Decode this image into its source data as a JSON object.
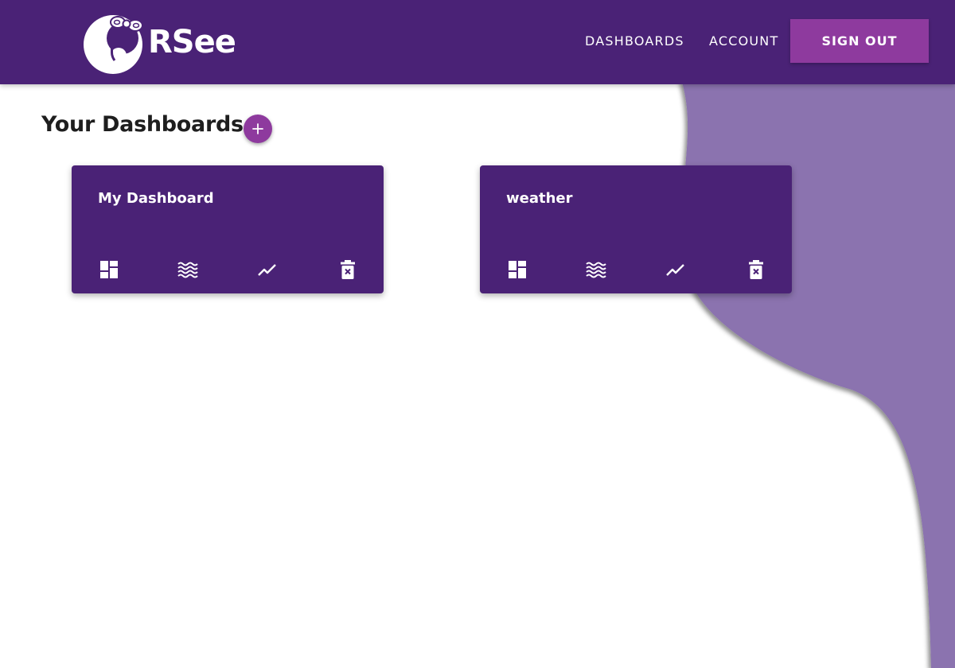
{
  "app": {
    "brand": "RSee",
    "brand_color": "#4a2276",
    "accent_color": "#8e3a9e",
    "wave_color": "#8b73af"
  },
  "header": {
    "nav": [
      {
        "label": "DASHBOARDS"
      },
      {
        "label": "ACCOUNT"
      }
    ],
    "signout_label": "SIGN OUT"
  },
  "main": {
    "title": "Your Dashboards",
    "add_icon": "plus-icon",
    "cards": [
      {
        "title": "My Dashboard",
        "actions": [
          "dashboard-icon",
          "waves-icon",
          "trending-icon",
          "delete-icon"
        ]
      },
      {
        "title": "weather",
        "actions": [
          "dashboard-icon",
          "waves-icon",
          "trending-icon",
          "delete-icon"
        ]
      }
    ]
  }
}
